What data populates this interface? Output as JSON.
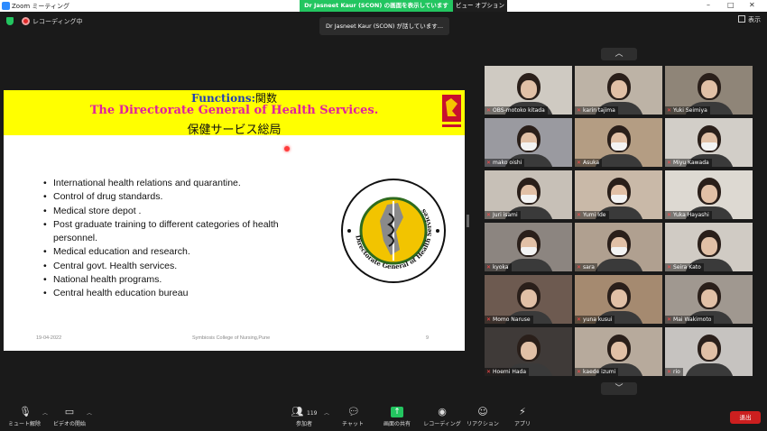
{
  "window": {
    "app_title": "Zoom ミーティング"
  },
  "share_banner": {
    "text": "Dr Jasneet Kaur (SCON) の画面を表示しています",
    "view_options": "ビュー オプション ⌄"
  },
  "window_controls": [
    "–",
    "□",
    "✕"
  ],
  "recording": {
    "label": "レコーディング中"
  },
  "speaker_toast": "Dr Jasneet Kaur (SCON) が話しています...",
  "layout_button": "表示",
  "slide": {
    "title_en": "Functions:",
    "title_jp": "関数",
    "subtitle": "The Directorate General of Health Services.",
    "subtitle_jp": "保健サービス総局",
    "bullets": [
      "International health relations and quarantine.",
      "Control of drug standards.",
      "Medical store depot .",
      " Post graduate training to different categories of health personnel.",
      "Medical education and research.",
      "Central govt. Health services.",
      "National health programs.",
      "Central health education bureau"
    ],
    "footer_date": "19-04-2022",
    "footer_org": "Symbiosis College of Nursing,Pune",
    "footer_page": "9",
    "emblem_text": "Directorate General of Health Services"
  },
  "participants": [
    {
      "name": "OBS-motoko kitada",
      "mask": false,
      "bg": "#cfcac2"
    },
    {
      "name": "karin tajima",
      "mask": false,
      "bg": "#bdb3a6"
    },
    {
      "name": "Yuki Seimiya",
      "mask": false,
      "bg": "#8f8578"
    },
    {
      "name": "mako oishi",
      "mask": true,
      "bg": "#9a9aa0"
    },
    {
      "name": "Asuka",
      "mask": true,
      "bg": "#b49d83"
    },
    {
      "name": "Miyu Kawada",
      "mask": true,
      "bg": "#d2cec8"
    },
    {
      "name": "Juri isami",
      "mask": true,
      "bg": "#c7c0b7"
    },
    {
      "name": "Yumi Ide",
      "mask": true,
      "bg": "#c9b9a8"
    },
    {
      "name": "Yuka Hayashi",
      "mask": false,
      "bg": "#ddd9d2"
    },
    {
      "name": "kyoka",
      "mask": true,
      "bg": "#8c8580"
    },
    {
      "name": "sara",
      "mask": true,
      "bg": "#b0a090"
    },
    {
      "name": "Seira Kato",
      "mask": false,
      "bg": "#d0cbc4"
    },
    {
      "name": "Momo Naruse",
      "mask": false,
      "bg": "#6d5a50"
    },
    {
      "name": "yuna kusui",
      "mask": false,
      "bg": "#a58a70"
    },
    {
      "name": "Mai Wakimoto",
      "mask": false,
      "bg": "#a09890"
    },
    {
      "name": "Hoemi Hada",
      "mask": false,
      "bg": "#3f3a38"
    },
    {
      "name": "kaede izumi",
      "mask": false,
      "bg": "#b7aa9c"
    },
    {
      "name": "rio",
      "mask": false,
      "bg": "#c6c3c0"
    }
  ],
  "toolbar": {
    "mute": "ミュート解除",
    "video": "ビデオの開始",
    "participants": "参加者",
    "participants_count": "119",
    "chat": "チャット",
    "share": "画面の共有",
    "record": "レコーディング",
    "reactions": "リアクション",
    "apps": "アプリ",
    "end": "退出"
  },
  "colors": {
    "share_green": "#23c560",
    "end_red": "#cc1f1f",
    "slide_yellow": "#ffff00",
    "title_blue": "#1f3fb6",
    "title_pink": "#e0209f"
  }
}
